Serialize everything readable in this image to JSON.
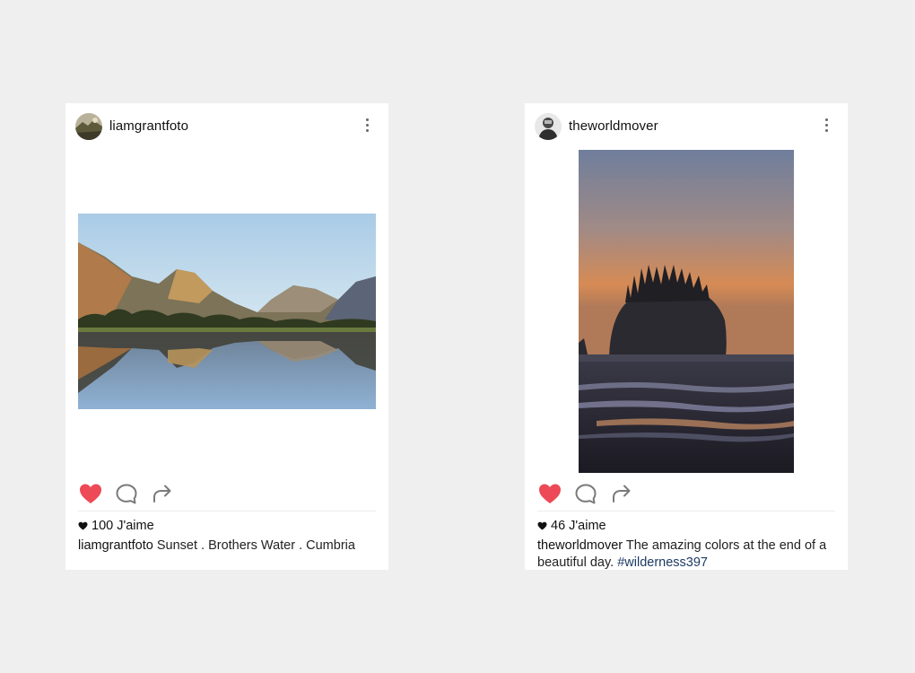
{
  "posts": [
    {
      "username": "liamgrantfoto",
      "likes": "100 J'aime",
      "caption_user": "liamgrantfoto",
      "caption_text": "Sunset . Brothers Water . Cumbria",
      "hashtag": "",
      "liked": true,
      "icons": [
        "avatar",
        "more-vertical-icon",
        "heart-icon",
        "comment-icon",
        "share-icon"
      ]
    },
    {
      "username": "theworldmover",
      "likes": "46 J'aime",
      "caption_user": "theworldmover",
      "caption_text": "The amazing colors at the end of a beautiful day.",
      "hashtag": "#wilderness397",
      "liked": true,
      "icons": [
        "avatar",
        "more-vertical-icon",
        "heart-icon",
        "comment-icon",
        "share-icon"
      ]
    }
  ],
  "colors": {
    "background": "#efefef",
    "card": "#ffffff",
    "like_red": "#ed4956",
    "hashtag": "#1d3b63",
    "icon_grey": "#7a7a7a"
  }
}
